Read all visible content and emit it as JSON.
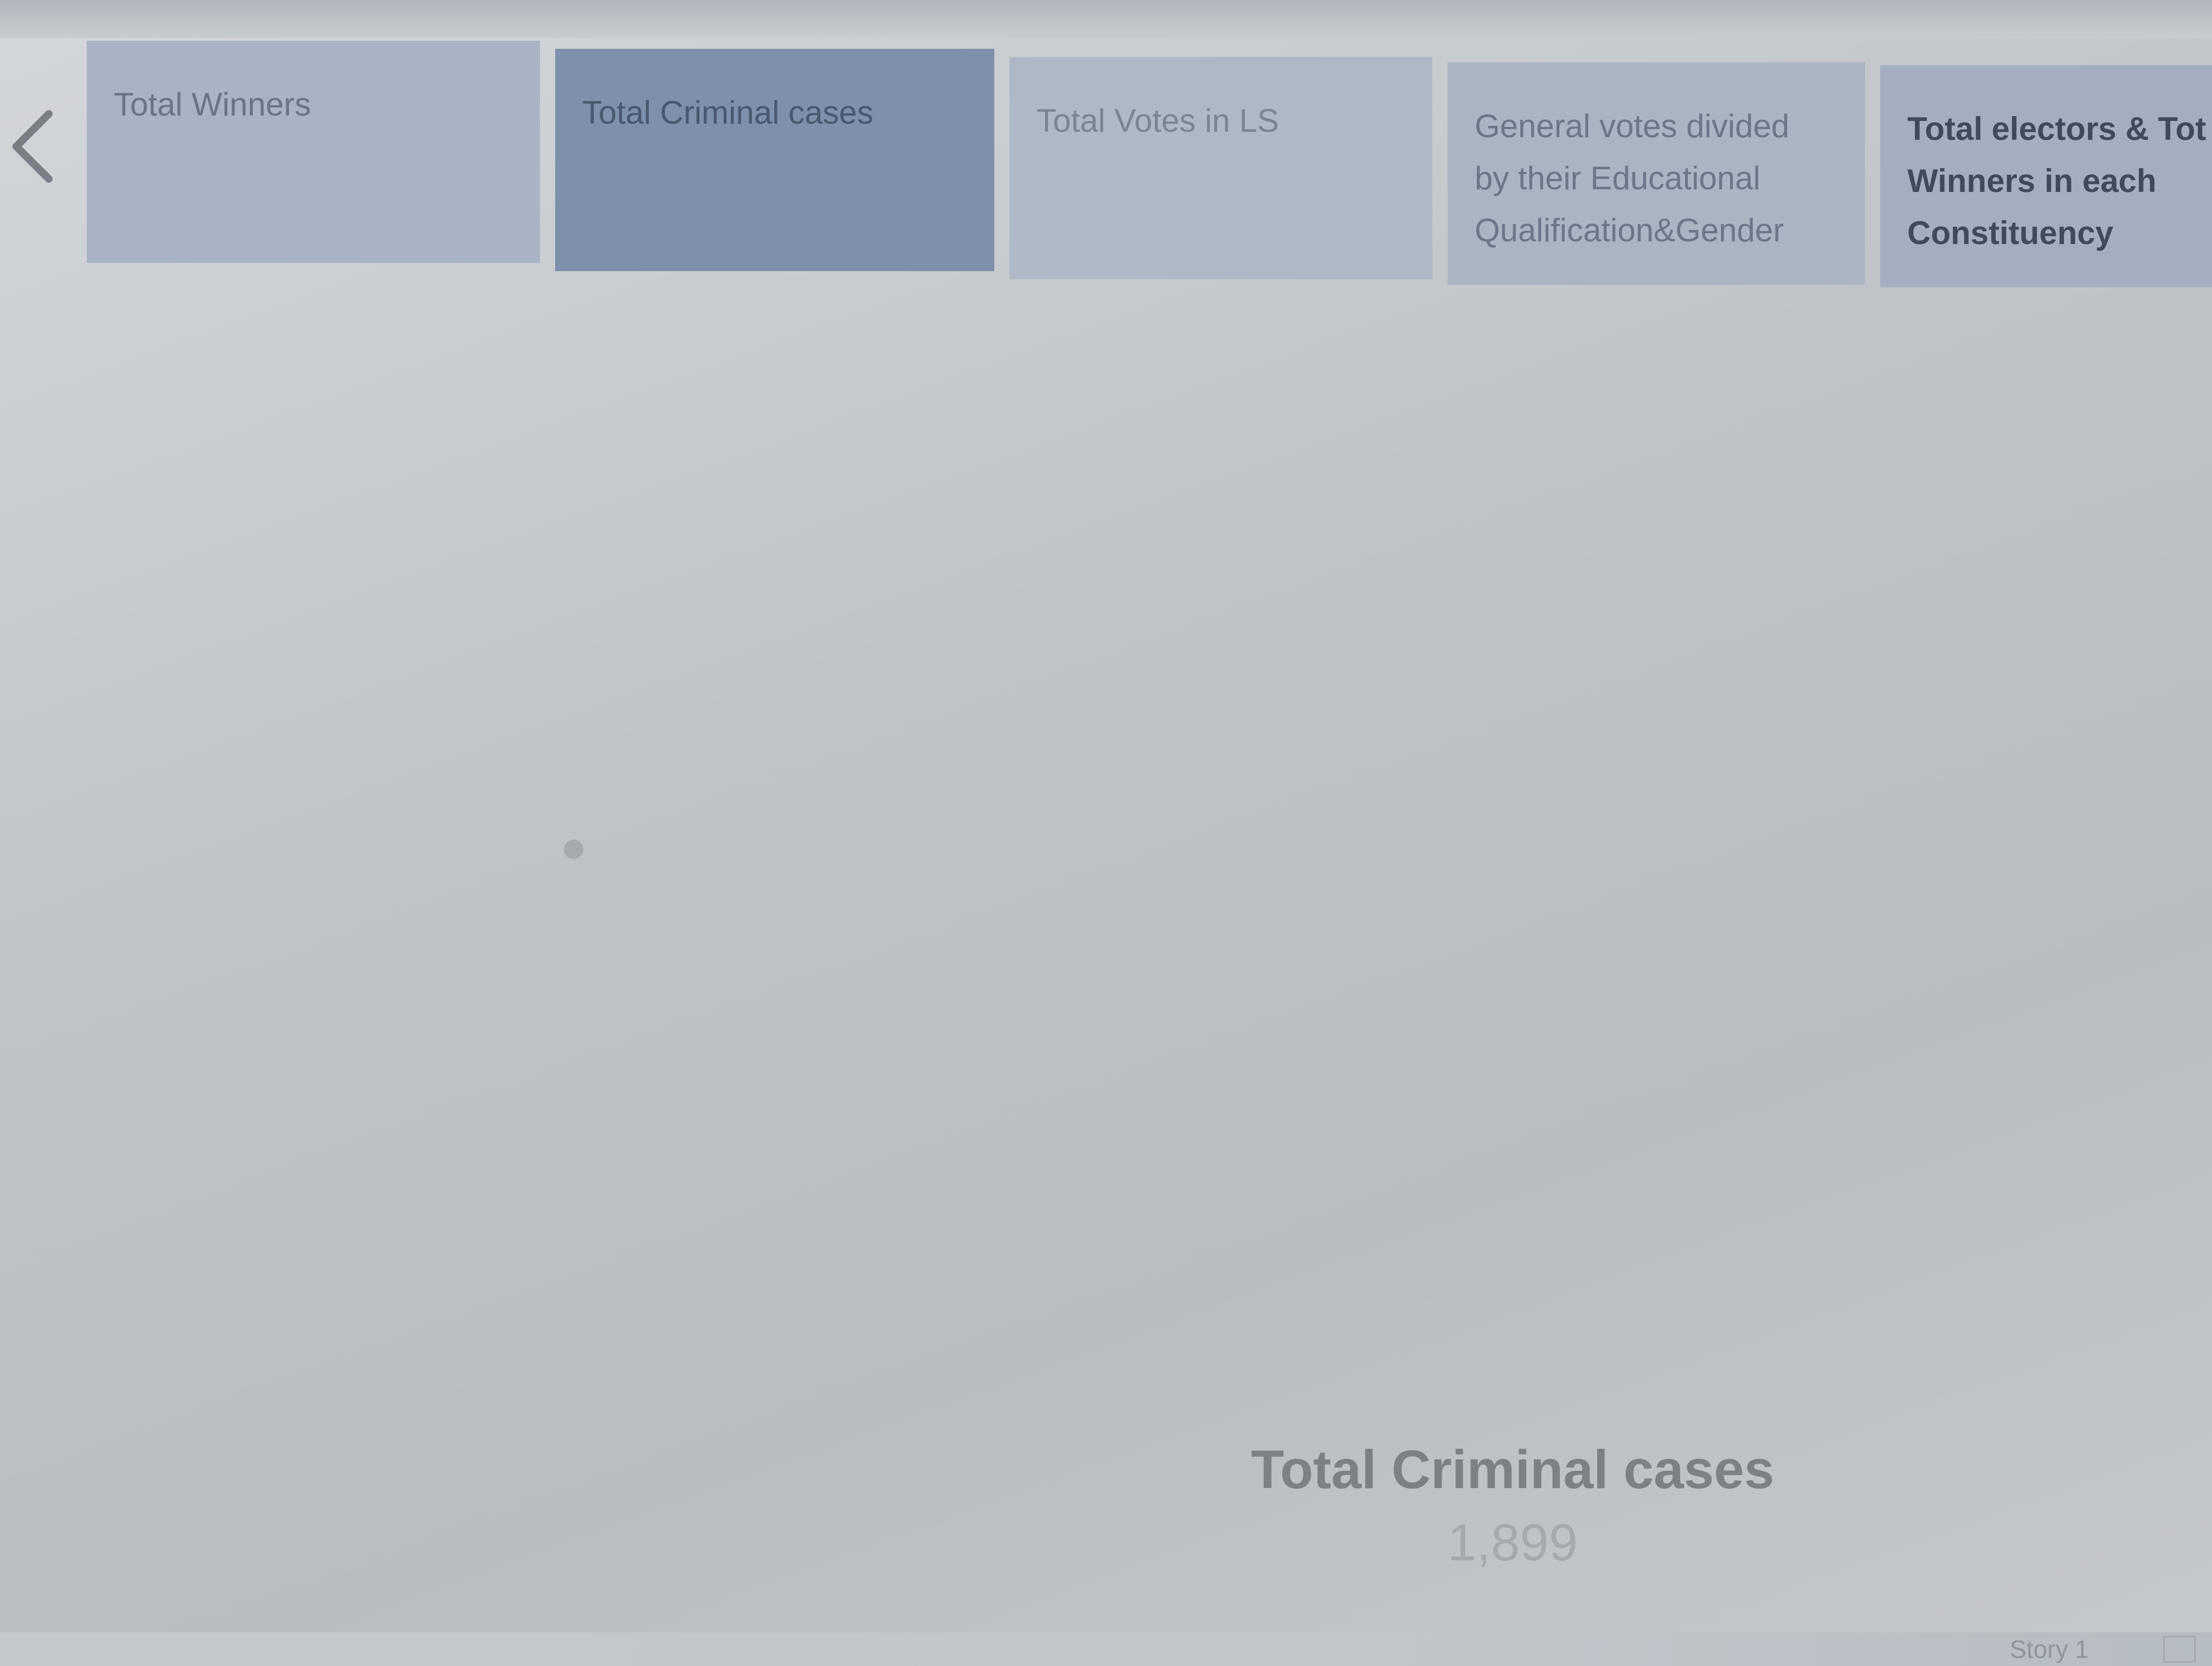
{
  "story": {
    "points": [
      {
        "lines": [
          "Total Winners"
        ]
      },
      {
        "lines": [
          "Total Criminal cases"
        ]
      },
      {
        "lines": [
          "Total Votes in LS"
        ]
      },
      {
        "lines": [
          "General votes divided",
          "by their Educational",
          "Qualification&Gender"
        ]
      },
      {
        "lines": [
          "Total electors & Tot",
          "Winners in each",
          "Constituency"
        ]
      }
    ],
    "active_index": 1
  },
  "caption": {
    "title": "Total Criminal cases",
    "value": "1,899"
  },
  "bottom_bar": {
    "sheet_tab_label": "Story 1"
  },
  "icons": {
    "prev": "chevron-left-icon",
    "new_sheet": "new-sheet-icon"
  },
  "colors": {
    "active_point": "#7e90ab",
    "inactive_point": "#a8b4c6",
    "background": "#c0c4c8"
  }
}
